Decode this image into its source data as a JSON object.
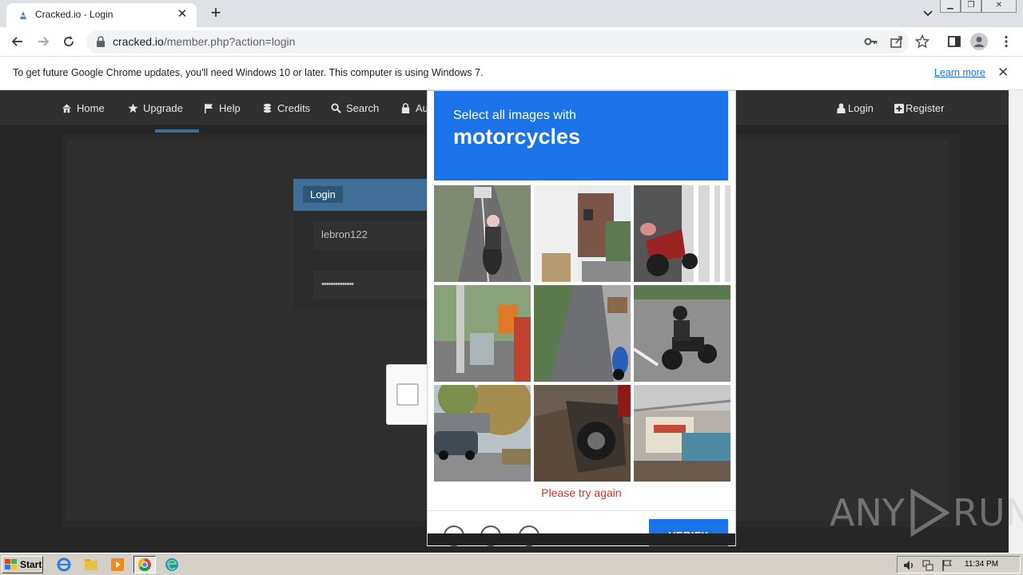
{
  "browser": {
    "tab_title": "Cracked.io - Login",
    "url_host": "cracked.io",
    "url_path": "/member.php?action=login"
  },
  "infobar": {
    "message": "To get future Google Chrome updates, you'll need Windows 10 or later. This computer is using Windows 7.",
    "link": "Learn more"
  },
  "sitenav": {
    "items": [
      {
        "label": "Home",
        "icon": "home-icon"
      },
      {
        "label": "Upgrade",
        "icon": "star-icon"
      },
      {
        "label": "Help",
        "icon": "flag-icon"
      },
      {
        "label": "Credits",
        "icon": "coins-icon"
      },
      {
        "label": "Search",
        "icon": "search-icon"
      },
      {
        "label": "Au",
        "icon": "lock-icon"
      }
    ],
    "right_items": [
      {
        "label": "Login",
        "icon": "user-icon"
      },
      {
        "label": "Register",
        "icon": "plus-square-icon"
      }
    ]
  },
  "login": {
    "title": "Login",
    "username": "lebron122",
    "password_mask": "••••••••••••••"
  },
  "captcha": {
    "prompt_line1": "Select all images with",
    "prompt_target": "motorcycles",
    "error": "Please try again",
    "verify_label": "VERIFY",
    "tiles": [
      {
        "desc": "motorcyclist on road"
      },
      {
        "desc": "house facade"
      },
      {
        "desc": "red motorcycle parked"
      },
      {
        "desc": "street with shops"
      },
      {
        "desc": "blue scooter on path"
      },
      {
        "desc": "motorcyclist riding"
      },
      {
        "desc": "parked car under tree"
      },
      {
        "desc": "truck tire on dirt"
      },
      {
        "desc": "market stall"
      }
    ]
  },
  "watermark": {
    "left": "ANY",
    "right": "RUN"
  },
  "taskbar": {
    "start_label": "Start",
    "time": "11:34 PM"
  },
  "colors": {
    "accent": "#1a73e8",
    "site_nav_bg": "#303030",
    "login_header": "#3f6f99",
    "error": "#d93025"
  }
}
